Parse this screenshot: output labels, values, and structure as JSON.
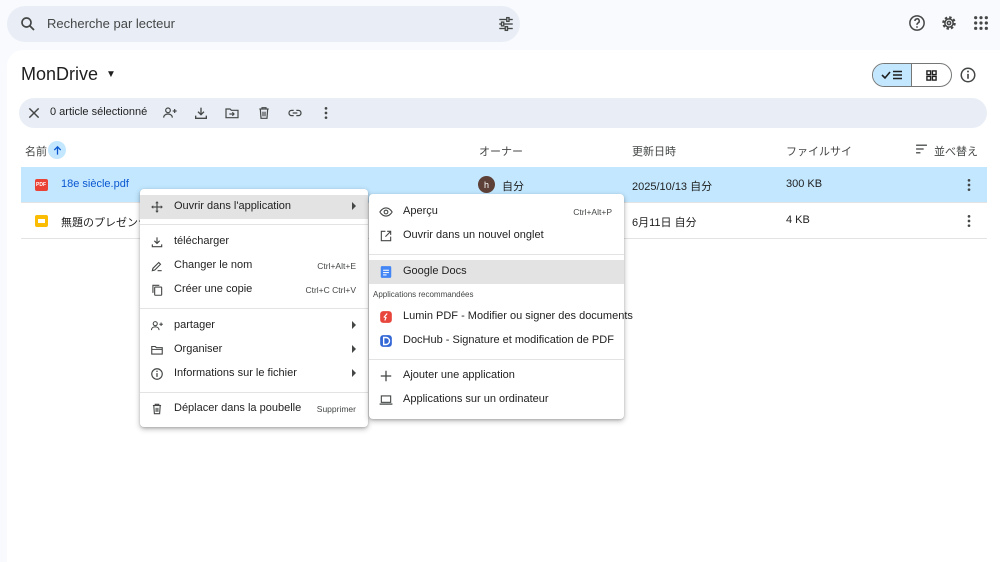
{
  "search": {
    "placeholder": "Recherche par lecteur"
  },
  "header": {
    "title": "MonDrive"
  },
  "selection_bar": {
    "text": "0 article sélectionné"
  },
  "table": {
    "columns": [
      "名前",
      "オーナー",
      "更新日時",
      "ファイルサイ",
      "並べ替え"
    ],
    "rows": [
      {
        "name": "18e siècle.pdf",
        "owner": "自分",
        "owner_initial": "h",
        "modified": "2025/10/13 自分",
        "size": "300 KB",
        "type": "pdf"
      },
      {
        "name": "無題のプレゼンテ",
        "owner": "",
        "modified": "6月11日 自分",
        "size": "4 KB",
        "type": "slides"
      }
    ]
  },
  "context_menu": {
    "items": [
      {
        "label": "Ouvrir dans l'application",
        "icon": "move-icon",
        "submenu": true
      },
      {
        "label": "télécharger",
        "icon": "download-icon"
      },
      {
        "label": "Changer le nom",
        "icon": "rename-icon",
        "shortcut": "Ctrl+Alt+E"
      },
      {
        "label": "Créer une copie",
        "icon": "copy-icon",
        "shortcut": "Ctrl+C Ctrl+V"
      },
      {
        "label": "partager",
        "icon": "share-icon",
        "submenu": true
      },
      {
        "label": "Organiser",
        "icon": "folder-icon",
        "submenu": true
      },
      {
        "label": "Informations sur le fichier",
        "icon": "info-icon",
        "submenu": true
      },
      {
        "label": "Déplacer dans la poubelle",
        "icon": "trash-icon",
        "shortcut": "Supprimer"
      }
    ]
  },
  "submenu": {
    "items": [
      {
        "label": "Aperçu",
        "icon": "eye-icon",
        "shortcut": "Ctrl+Alt+P"
      },
      {
        "label": "Ouvrir dans un nouvel onglet",
        "icon": "open-new-tab-icon"
      },
      {
        "label": "Google Docs",
        "icon": "google-docs-icon"
      },
      {
        "label": "Lumin PDF - Modifier ou signer des documents",
        "icon": "lumin-pdf-icon"
      },
      {
        "label": "DocHub - Signature et modification de PDF",
        "icon": "dochub-icon"
      },
      {
        "label": "Ajouter une application",
        "icon": "plus-icon"
      },
      {
        "label": "Applications sur un ordinateur",
        "icon": "laptop-icon"
      }
    ],
    "recommended_header": "Applications recommandées"
  },
  "colors": {
    "accent": "#0b57d0",
    "selected_row": "#c2e7ff",
    "pdf": "#ea4335",
    "slides": "#fbbc04",
    "docs": "#4285f4"
  }
}
